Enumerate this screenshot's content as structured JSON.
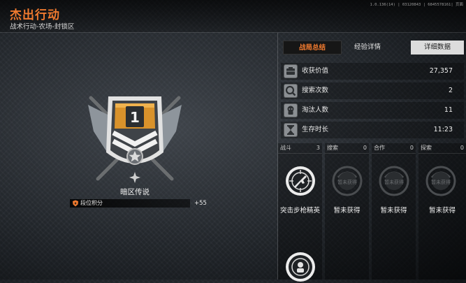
{
  "header": {
    "title": "杰出行动",
    "subtitle": "战术行动-农场-封锁区",
    "version": "1.0.136(14) | 03120843 | 6845578161| 页面"
  },
  "rank": {
    "level": "1",
    "name": "暗区传说",
    "points_label": "段位积分",
    "points_value": "+55"
  },
  "tabs": {
    "summary": "战局总结",
    "experience": "经验详情",
    "detail": "详细数据"
  },
  "stats": [
    {
      "label": "收获价值",
      "value": "27,357",
      "icon": "value-icon"
    },
    {
      "label": "搜索次数",
      "value": "2",
      "icon": "search-icon"
    },
    {
      "label": "淘汰人数",
      "value": "11",
      "icon": "elimination-icon"
    },
    {
      "label": "生存时长",
      "value": "11:23",
      "icon": "hourglass-icon"
    }
  ],
  "categories": [
    {
      "label": "战斗",
      "count": "3",
      "caption": "突击步枪精英",
      "medal": "rifle-medal-icon"
    },
    {
      "label": "搜索",
      "count": "0",
      "caption": "暂未获得",
      "medal": "locked-medal-icon"
    },
    {
      "label": "合作",
      "count": "0",
      "caption": "暂未获得",
      "medal": "locked-medal-icon"
    },
    {
      "label": "探索",
      "count": "0",
      "caption": "暂未获得",
      "medal": "locked-medal-icon"
    }
  ],
  "locked_medal_text": "暂未获得",
  "colors": {
    "accent": "#f07a2f",
    "badge_gold": "#d9922b",
    "panel_dark": "#161616"
  }
}
